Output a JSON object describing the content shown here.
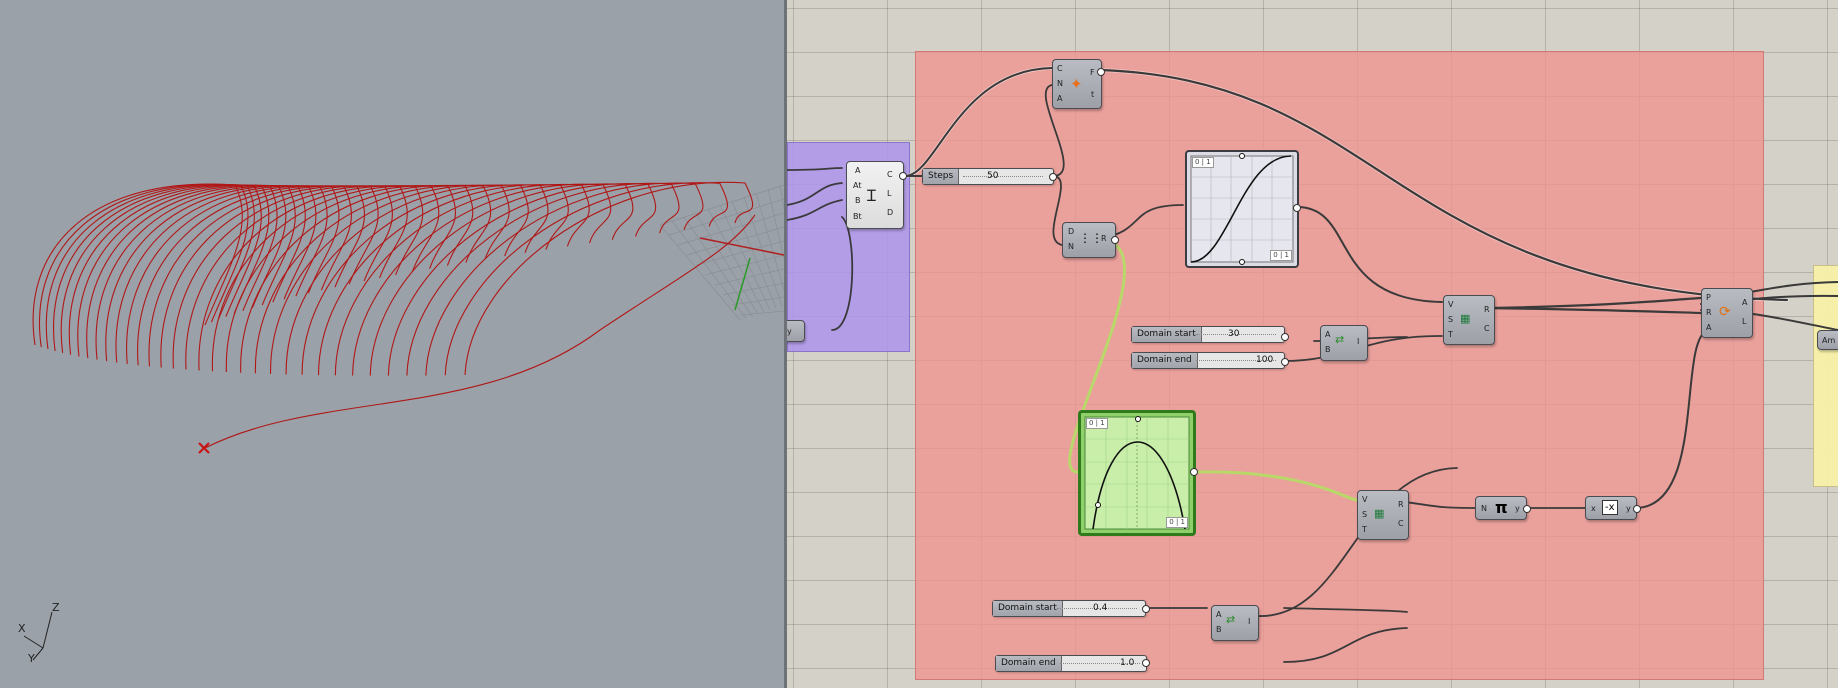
{
  "viewport": {
    "axis_labels": {
      "x": "X",
      "y": "Y",
      "z": "Z"
    },
    "colors": {
      "background": "#9ba1a8",
      "curves": "#b01818",
      "marker": "#c81414"
    }
  },
  "canvas": {
    "sliders": {
      "steps": {
        "label": "Steps",
        "value": "50"
      },
      "domain_start_1": {
        "label": "Domain start",
        "value": "30"
      },
      "domain_end_1": {
        "label": "Domain end",
        "value": "100"
      },
      "domain_start_2": {
        "label": "Domain start",
        "value": "0.4"
      },
      "domain_end_2": {
        "label": "Domain end",
        "value": "1.0"
      }
    },
    "components": {
      "divide": {
        "inputs": [
          "C",
          "N",
          "A"
        ],
        "outputs": [
          "F",
          "t"
        ]
      },
      "tween": {
        "inputs": [
          "A",
          "At",
          "B",
          "Bt"
        ],
        "outputs": [
          "C",
          "L",
          "D"
        ]
      },
      "range": {
        "inputs": [
          "D",
          "N"
        ],
        "outputs": [
          "R"
        ]
      },
      "construct_domain_1": {
        "inputs": [
          "A",
          "B"
        ],
        "outputs": [
          "I"
        ]
      },
      "construct_domain_2": {
        "inputs": [
          "A",
          "B"
        ],
        "outputs": [
          "I"
        ]
      },
      "remap_1": {
        "inputs": [
          "V",
          "S",
          "T"
        ],
        "outputs": [
          "R",
          "C"
        ]
      },
      "remap_2": {
        "inputs": [
          "V",
          "S",
          "T"
        ],
        "outputs": [
          "R",
          "C"
        ]
      },
      "pi": {
        "inputs": [
          "N"
        ],
        "outputs": [
          "y"
        ]
      },
      "negative": {
        "inputs": [
          "x"
        ],
        "outputs": [
          "y"
        ],
        "symbol": "-x"
      },
      "rotate": {
        "inputs": [
          "P",
          "R",
          "A"
        ],
        "outputs": [
          "A",
          "L"
        ]
      },
      "expression_fragment": {
        "outputs": [
          "y"
        ]
      },
      "yellow_fragment": {
        "label": "Am"
      }
    },
    "graphs": {
      "sigmoid": {
        "tag_top": "0 | 1",
        "tag_bottom": "0 | 1"
      },
      "parabola": {
        "tag_top": "0 | 1",
        "tag_bottom": "0 | 1"
      }
    },
    "colors": {
      "group_red": "#f0928e",
      "group_purple": "#ad94ec",
      "group_yellow": "#f7f0a8",
      "wire": "#3a3a3a",
      "wire_selected": "#b8d86a"
    }
  }
}
